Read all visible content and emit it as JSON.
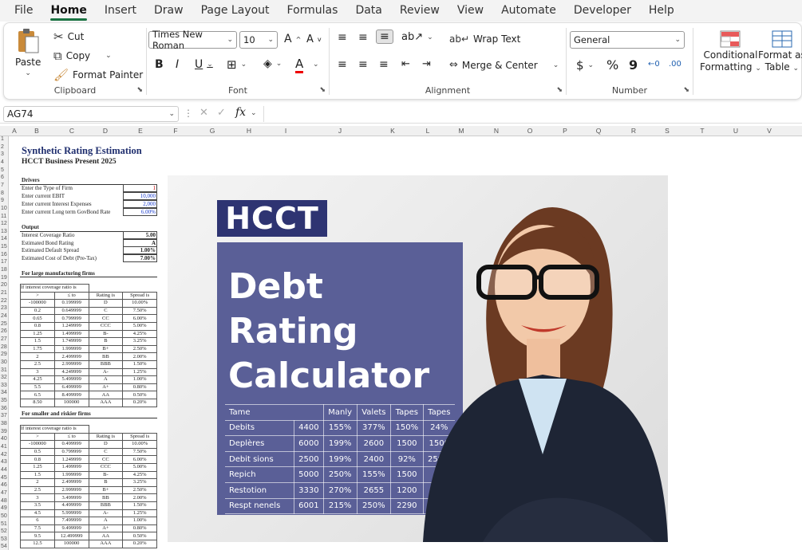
{
  "menu": [
    "File",
    "Home",
    "Insert",
    "Draw",
    "Page Layout",
    "Formulas",
    "Data",
    "Review",
    "View",
    "Automate",
    "Developer",
    "Help"
  ],
  "ribbon": {
    "paste": "Paste",
    "cut": "Cut",
    "copy": "Copy",
    "format_painter": "Format Painter",
    "clipboard": "Clipboard",
    "font_name": "Times New Roman",
    "font_size": "10",
    "font": "Font",
    "wrap": "Wrap Text",
    "merge": "Merge & Center",
    "alignment": "Alignment",
    "number_format": "General",
    "number": "Number",
    "currency": "$",
    "percent": "%",
    "comma": "9",
    "inc_decimal": ".00",
    "cond1": "Conditional",
    "cond2": "Formatting",
    "fmt1": "Format as",
    "fmt2": "Table"
  },
  "namebox": "AG74",
  "fx": "fx",
  "columns": [
    "A",
    "B",
    "C",
    "D",
    "E",
    "F",
    "G",
    "H",
    "I",
    "J",
    "K",
    "L",
    "M",
    "N",
    "O",
    "P",
    "Q",
    "R",
    "S",
    "T",
    "U",
    "V"
  ],
  "sheet": {
    "title": "Synthetic Rating Estimation",
    "subtitle": "HCCT Business Present 2025",
    "drivers": "Drivers",
    "d1": "Enter the Type of Firm",
    "d1v": "1",
    "d2": "Enter current EBIT",
    "d2v": "10,000",
    "d3": "Enter current Interest Expenses",
    "d3v": "2,000",
    "d4": "Enter current Long term GovBond Rate",
    "d4v": "6.00%",
    "output": "Output",
    "o1": "Interest Coverage Ratio",
    "o1v": "5.00",
    "o2": "Estimated Bond Rating",
    "o2v": "A",
    "o3": "Estimated Default Spread",
    "o3v": "1.00%",
    "o4": "Estimated Cost of Debt (Pre-Tax)",
    "o4v": "7.00%",
    "large": "For large manufacturing firms",
    "small": "For smaller and riskier firms",
    "tbl_header": "If interest coverage ratio is",
    "col_gt": ">",
    "col_le": "≤ to",
    "col_rating": "Rating is",
    "col_spread": "Spread is",
    "large_rows": [
      [
        "-100000",
        "0.199999",
        "D",
        "10.00%"
      ],
      [
        "0.2",
        "0.649999",
        "C",
        "7.50%"
      ],
      [
        "0.65",
        "0.799999",
        "CC",
        "6.00%"
      ],
      [
        "0.8",
        "1.249999",
        "CCC",
        "5.00%"
      ],
      [
        "1.25",
        "1.499999",
        "B-",
        "4.25%"
      ],
      [
        "1.5",
        "1.749999",
        "B",
        "3.25%"
      ],
      [
        "1.75",
        "1.999999",
        "B+",
        "2.50%"
      ],
      [
        "2",
        "2.499999",
        "BB",
        "2.00%"
      ],
      [
        "2.5",
        "2.999999",
        "BBB",
        "1.50%"
      ],
      [
        "3",
        "4.249999",
        "A-",
        "1.25%"
      ],
      [
        "4.25",
        "5.499999",
        "A",
        "1.00%"
      ],
      [
        "5.5",
        "6.499999",
        "A+",
        "0.80%"
      ],
      [
        "6.5",
        "8.499999",
        "AA",
        "0.50%"
      ],
      [
        "8.50",
        "100000",
        "AAA",
        "0.20%"
      ]
    ],
    "small_rows": [
      [
        "-100000",
        "0.499999",
        "D",
        "10.00%"
      ],
      [
        "0.5",
        "0.799999",
        "C",
        "7.50%"
      ],
      [
        "0.8",
        "1.249999",
        "CC",
        "6.00%"
      ],
      [
        "1.25",
        "1.499999",
        "CCC",
        "5.00%"
      ],
      [
        "1.5",
        "1.999999",
        "B-",
        "4.25%"
      ],
      [
        "2",
        "2.499999",
        "B",
        "3.25%"
      ],
      [
        "2.5",
        "2.999999",
        "B+",
        "2.50%"
      ],
      [
        "3",
        "3.499999",
        "BB",
        "2.00%"
      ],
      [
        "3.5",
        "4.499999",
        "BBB",
        "1.50%"
      ],
      [
        "4.5",
        "5.999999",
        "A-",
        "1.25%"
      ],
      [
        "6",
        "7.499999",
        "A",
        "1.00%"
      ],
      [
        "7.5",
        "9.499999",
        "A+",
        "0.80%"
      ],
      [
        "9.5",
        "12.499999",
        "AA",
        "0.50%"
      ],
      [
        "12.5",
        "100000",
        "AAA",
        "0.20%"
      ]
    ]
  },
  "poster": {
    "logo": "HCCT",
    "line1": "Debt",
    "line2": "Rating",
    "line3": "Calculator",
    "header": [
      "Tame",
      "Manly",
      "Valets",
      "Tapes",
      "Tapes"
    ],
    "rows": [
      [
        "Debits",
        "4400",
        "155%",
        "377%",
        "150%",
        "24%"
      ],
      [
        "Deplères",
        "6000",
        "199%",
        "2600",
        "1500",
        "1500"
      ],
      [
        "Debit sions",
        "2500",
        "199%",
        "2400",
        "92%",
        "259%"
      ],
      [
        "Repich",
        "5000",
        "250%",
        "155%",
        "1500",
        "2!"
      ],
      [
        "Restotion",
        "3330",
        "270%",
        "2655",
        "1200",
        ""
      ],
      [
        "Respt nenels",
        "6001",
        "215%",
        "250%",
        "2290",
        ""
      ]
    ]
  },
  "colors": {
    "accent": "#1a7343",
    "logo_bg": "#2e3472",
    "panel_bg": "#5a5f97",
    "title_blue": "#1f2e6e"
  }
}
